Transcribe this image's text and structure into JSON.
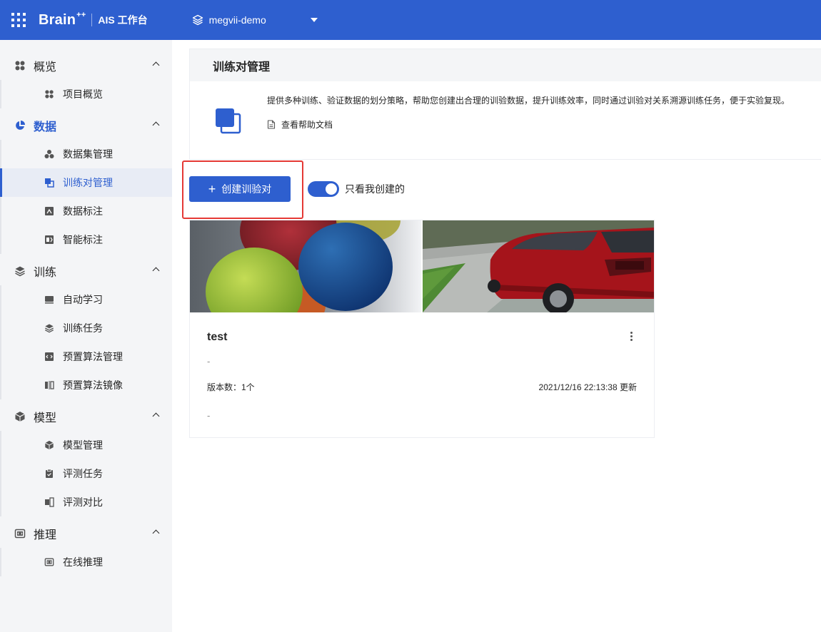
{
  "topbar": {
    "brand": "Brain",
    "brand_sup": "++",
    "product": "AIS 工作台",
    "project": "megvii-demo"
  },
  "sidebar": {
    "groups": [
      {
        "label": "概览",
        "icon": "overview-icon",
        "children": [
          {
            "label": "项目概览",
            "icon": "overview-icon"
          }
        ]
      },
      {
        "label": "数据",
        "icon": "pie-icon",
        "active": true,
        "children": [
          {
            "label": "数据集管理",
            "icon": "dataset-icon"
          },
          {
            "label": "训练对管理",
            "icon": "pair-icon",
            "active": true
          },
          {
            "label": "数据标注",
            "icon": "annotate-icon"
          },
          {
            "label": "智能标注",
            "icon": "smart-annotate-icon"
          }
        ]
      },
      {
        "label": "训练",
        "icon": "layers-icon",
        "children": [
          {
            "label": "自动学习",
            "icon": "auto-learn-icon"
          },
          {
            "label": "训练任务",
            "icon": "layers-icon"
          },
          {
            "label": "预置算法管理",
            "icon": "code-icon"
          },
          {
            "label": "预置算法镜像",
            "icon": "mirror-icon"
          }
        ]
      },
      {
        "label": "模型",
        "icon": "cube-icon",
        "children": [
          {
            "label": "模型管理",
            "icon": "cube-icon"
          },
          {
            "label": "评测任务",
            "icon": "clipboard-icon"
          },
          {
            "label": "评测对比",
            "icon": "compare-icon"
          }
        ]
      },
      {
        "label": "推理",
        "icon": "inference-icon",
        "children": [
          {
            "label": "在线推理",
            "icon": "inference-icon"
          }
        ]
      }
    ]
  },
  "page": {
    "title": "训练对管理",
    "description": "提供多种训练、验证数据的划分策略，帮助您创建出合理的训验数据，提升训练效率，同时通过训验对关系溯源训练任务，便于实验复现。",
    "help_link": "查看帮助文档",
    "create_button": "创建训验对",
    "create_plus": "+",
    "only_mine_label": "只看我创建的",
    "only_mine_on": true
  },
  "card": {
    "title": "test",
    "description": "-",
    "version_count": "版本数：1个",
    "updated": "2021/12/16 22:13:38 更新",
    "footer": "-"
  },
  "colors": {
    "primary": "#2e5fcf",
    "sidebar_bg": "#f4f5f7",
    "highlight": "#e53935"
  }
}
